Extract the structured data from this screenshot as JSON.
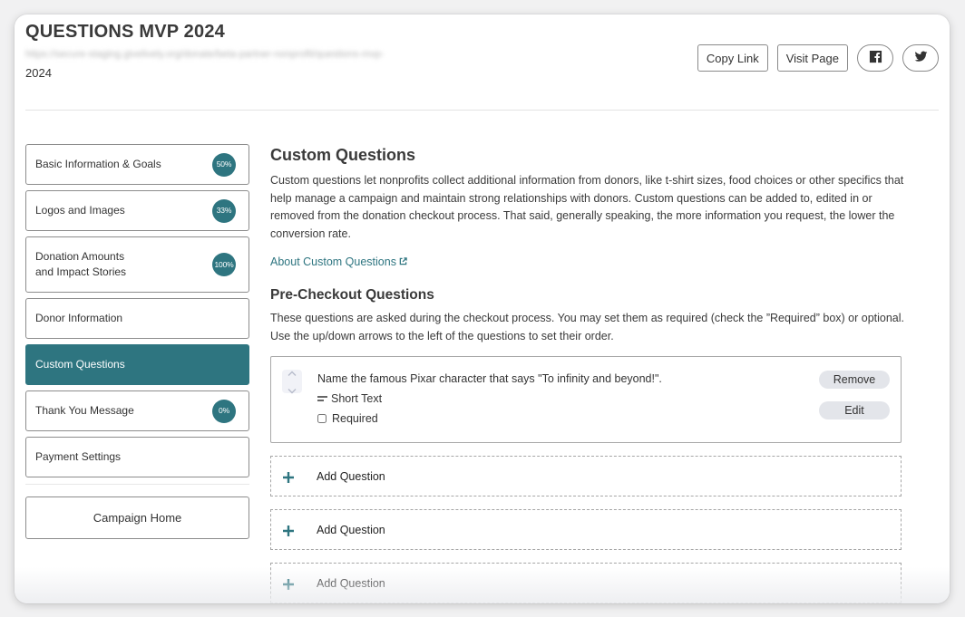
{
  "header": {
    "title": "QUESTIONS MVP 2024",
    "url_blurred": "https://secure-staging.givelively.org/donate/beta-partner-nonprofit/questions-mvp-",
    "url_suffix": "2024",
    "actions": {
      "copy_link": "Copy Link",
      "visit_page": "Visit Page",
      "facebook_icon": "facebook-icon",
      "twitter_icon": "twitter-icon"
    }
  },
  "sidebar": {
    "items": [
      {
        "label": "Basic Information & Goals",
        "badge": "50%",
        "progress": 0.5
      },
      {
        "label": "Logos and Images",
        "badge": "33%",
        "progress": 0.33
      },
      {
        "label_line1": "Donation Amounts",
        "label_line2": "and Impact Stories",
        "badge": "100%",
        "progress": 1.0
      },
      {
        "label": "Donor Information"
      },
      {
        "label": "Custom Questions",
        "active": true
      },
      {
        "label": "Thank You Message",
        "badge": "0%",
        "progress": 0.0
      },
      {
        "label": "Payment Settings"
      }
    ],
    "campaign_home": "Campaign Home"
  },
  "main": {
    "title": "Custom Questions",
    "intro": "Custom questions let nonprofits collect additional information from donors, like t-shirt sizes, food choices or other specifics that help manage a campaign and maintain strong relationships with donors. Custom questions can be added to, edited in or removed from the donation checkout process. That said, generally speaking, the more information you request, the lower the conversion rate.",
    "about_link": "About Custom Questions",
    "pre_checkout": {
      "title": "Pre-Checkout Questions",
      "description": "These questions are asked during the checkout process. You may set them as required (check the ”Required” box) or optional. Use the up/down arrows to the left of the questions to set their order.",
      "questions": [
        {
          "text": "Name the famous Pixar character that says \"To infinity and beyond!\".",
          "type": "Short Text",
          "required_label": "Required",
          "required": false,
          "remove_label": "Remove",
          "edit_label": "Edit"
        }
      ],
      "add_question_slots": [
        {
          "label": "Add Question"
        },
        {
          "label": "Add Question"
        },
        {
          "label": "Add Question"
        }
      ]
    }
  },
  "colors": {
    "accent": "#2e7580",
    "pill_bg": "#e3e5ea",
    "border": "#8c8c8c"
  }
}
